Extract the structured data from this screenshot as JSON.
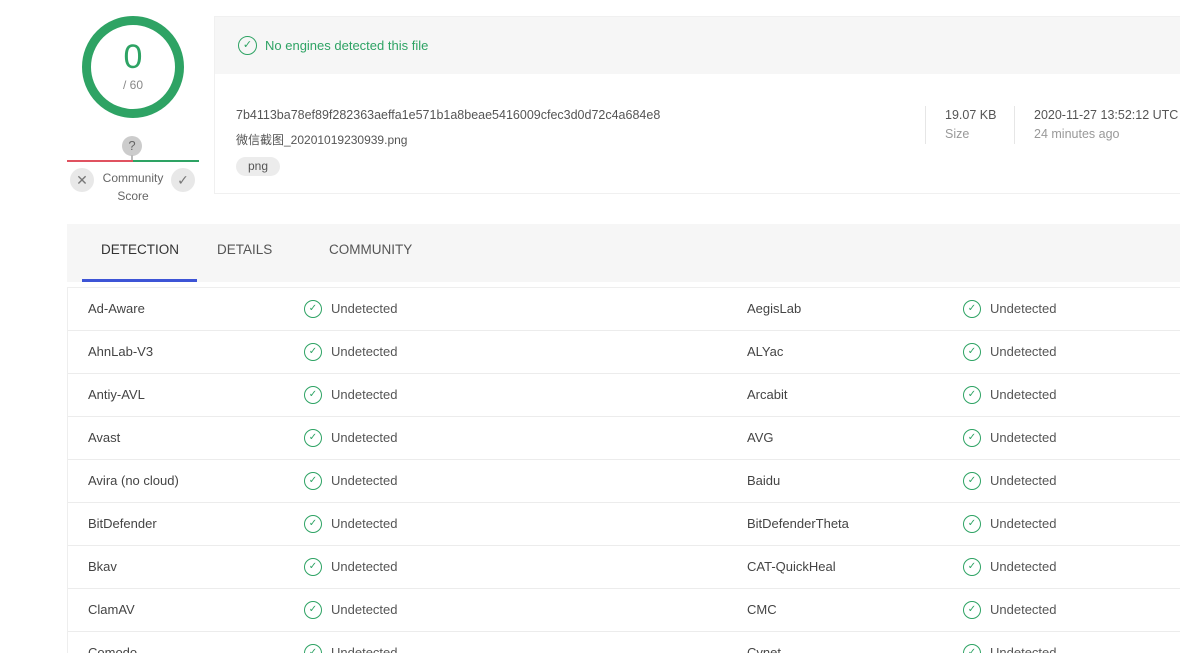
{
  "score": {
    "detected": "0",
    "total": "/ 60"
  },
  "community": {
    "question": "?",
    "label_line1": "Community",
    "label_line2": "Score",
    "down_icon": "✕",
    "up_icon": "✓"
  },
  "banner": {
    "icon": "✓",
    "text": "No engines detected this file"
  },
  "file": {
    "hash": "7b4113ba78ef89f282363aeffa1e571b1a8beae5416009cfec3d0d72c4a684e8",
    "name": "微信截图_20201019230939.png",
    "tag": "png",
    "size_value": "19.07 KB",
    "size_label": "Size",
    "date_value": "2020-11-27 13:52:12 UTC",
    "date_label": "24 minutes ago"
  },
  "tabs": {
    "detection": "DETECTION",
    "details": "DETAILS",
    "community": "COMMUNITY"
  },
  "results": {
    "status": "Undetected",
    "rows": [
      {
        "left": "Ad-Aware",
        "right": "AegisLab"
      },
      {
        "left": "AhnLab-V3",
        "right": "ALYac"
      },
      {
        "left": "Antiy-AVL",
        "right": "Arcabit"
      },
      {
        "left": "Avast",
        "right": "AVG"
      },
      {
        "left": "Avira (no cloud)",
        "right": "Baidu"
      },
      {
        "left": "BitDefender",
        "right": "BitDefenderTheta"
      },
      {
        "left": "Bkav",
        "right": "CAT-QuickHeal"
      },
      {
        "left": "ClamAV",
        "right": "CMC"
      },
      {
        "left": "Comodo",
        "right": "Cynet"
      }
    ]
  },
  "colors": {
    "clean": "#2ea364",
    "tab_accent": "#3d54d6",
    "negative": "#e05260"
  },
  "icons": {
    "check": "check-circle-icon",
    "question": "question-icon",
    "thumbs_down": "close-icon",
    "thumbs_up": "check-icon"
  }
}
